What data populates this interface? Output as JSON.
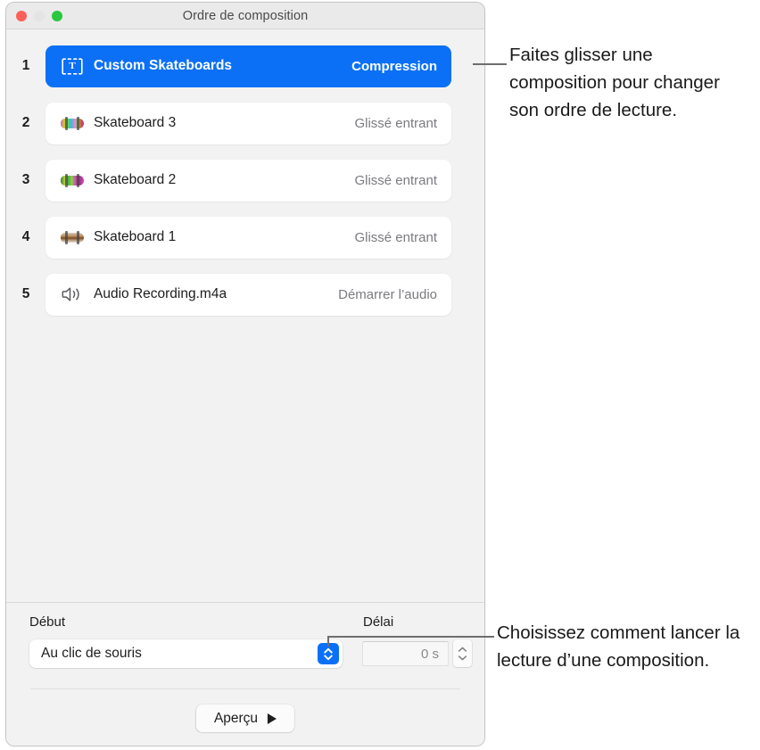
{
  "window": {
    "title": "Ordre de composition",
    "traffic_lights": [
      "close-button",
      "minimize-button",
      "zoom-button"
    ]
  },
  "list": {
    "rows": [
      {
        "number": "1",
        "icon": "text-box-icon",
        "name": "Custom Skateboards",
        "effect": "Compression",
        "selected": true
      },
      {
        "number": "2",
        "icon": "skateboard-3-thumbnail",
        "name": "Skateboard 3",
        "effect": "Glissé entrant",
        "selected": false
      },
      {
        "number": "3",
        "icon": "skateboard-2-thumbnail",
        "name": "Skateboard 2",
        "effect": "Glissé entrant",
        "selected": false
      },
      {
        "number": "4",
        "icon": "skateboard-1-thumbnail",
        "name": "Skateboard 1",
        "effect": "Glissé entrant",
        "selected": false
      },
      {
        "number": "5",
        "icon": "speaker-icon",
        "name": "Audio Recording.m4a",
        "effect": "Démarrer l’audio",
        "selected": false
      }
    ]
  },
  "controls": {
    "start_label": "Début",
    "start_value": "Au clic de souris",
    "delay_label": "Délai",
    "delay_value": "0 s",
    "preview_label": "Aperçu"
  },
  "callouts": {
    "top": "Faites glisser une composition pour changer son ordre de lecture.",
    "bottom": "Choisissez comment lancer la lecture d’une composition."
  },
  "colors": {
    "accent_blue": "#0b70f5",
    "window_background": "#f2f2f2",
    "row_background": "#ffffff",
    "secondary_text": "#7b7b80",
    "leader_line": "#6e6e6e"
  }
}
